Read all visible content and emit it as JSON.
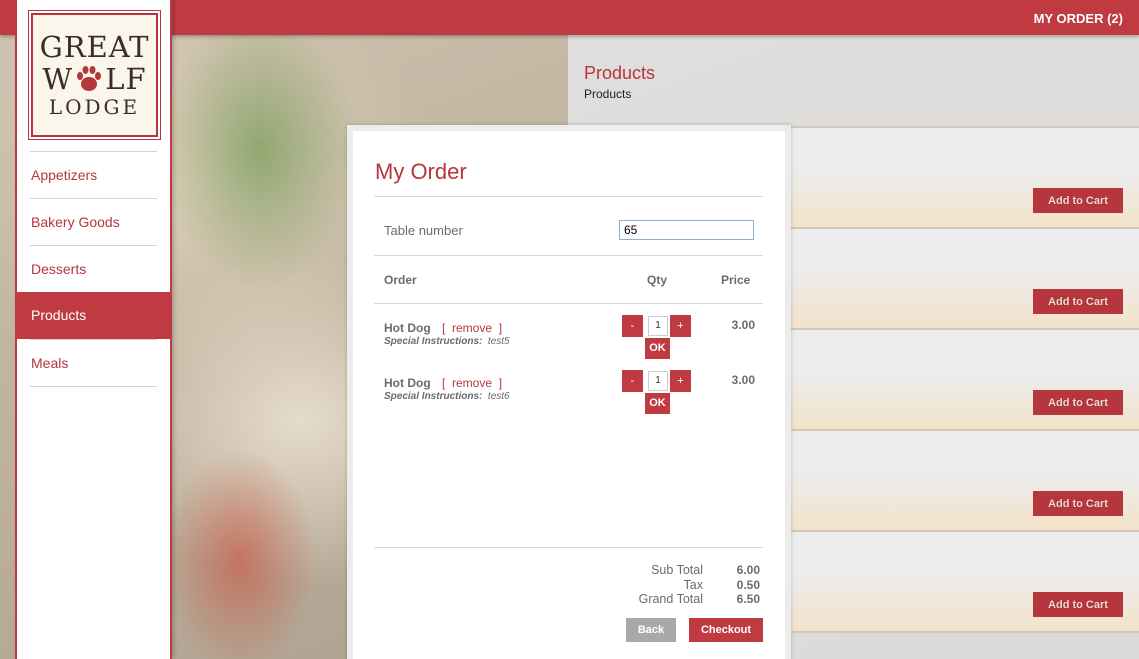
{
  "header": {
    "my_order": "MY ORDER (2)"
  },
  "logo": {
    "line1": "GREAT",
    "line2_left": "W",
    "line2_right": "LF",
    "line3": "LODGE"
  },
  "sidebar": {
    "items": [
      {
        "label": "Appetizers",
        "active": false
      },
      {
        "label": "Bakery Goods",
        "active": false
      },
      {
        "label": "Desserts",
        "active": false
      },
      {
        "label": "Products",
        "active": true
      },
      {
        "label": "Meals",
        "active": false
      }
    ]
  },
  "products": {
    "title": "Products",
    "subtitle": "Products",
    "add_to_cart_label": "Add to Cart"
  },
  "modal": {
    "title": "My Order",
    "table_label": "Table number",
    "table_value": "65",
    "columns": {
      "order": "Order",
      "qty": "Qty",
      "price": "Price"
    },
    "remove_label": "remove",
    "instructions_label": "Special Instructions:",
    "ok_label": "OK",
    "minus": "-",
    "plus": "+",
    "items": [
      {
        "name": "Hot Dog",
        "instructions": "test5",
        "qty": "1",
        "price": "3.00"
      },
      {
        "name": "Hot Dog",
        "instructions": "test6",
        "qty": "1",
        "price": "3.00"
      }
    ],
    "totals": {
      "subtotal_label": "Sub Total",
      "subtotal": "6.00",
      "tax_label": "Tax",
      "tax": "0.50",
      "grand_label": "Grand Total",
      "grand": "6.50"
    },
    "back_label": "Back",
    "checkout_label": "Checkout"
  },
  "colors": {
    "brand_red": "#bf3a41",
    "link_red": "#b5363c",
    "grey_button": "#a9a9a9"
  }
}
